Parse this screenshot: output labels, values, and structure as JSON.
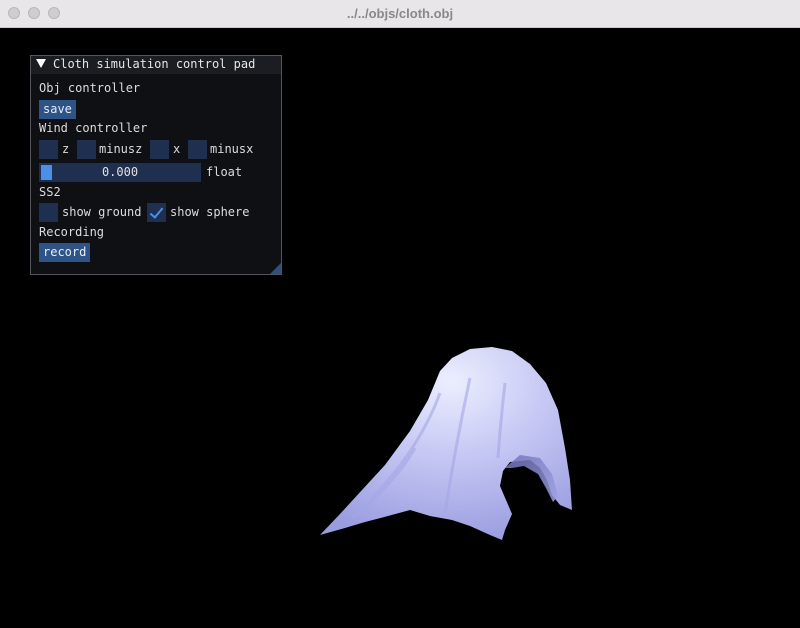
{
  "window": {
    "title": "../../objs/cloth.obj"
  },
  "panel": {
    "title": "Cloth simulation control pad",
    "obj_section": "Obj controller",
    "save_label": "save",
    "wind_section": "Wind controller",
    "wind_checks": [
      {
        "label": "z",
        "checked": false
      },
      {
        "label": "minusz",
        "checked": false
      },
      {
        "label": "x",
        "checked": false
      },
      {
        "label": "minusx",
        "checked": false
      }
    ],
    "slider_value": "0.000",
    "slider_label": "float",
    "ss2_section": "SS2",
    "show_ground_label": "show ground",
    "show_ground_checked": false,
    "show_sphere_label": "show sphere",
    "show_sphere_checked": true,
    "recording_section": "Recording",
    "record_label": "record"
  },
  "colors": {
    "cloth": "#c8caf6",
    "accent": "#4a90e8",
    "button": "#2e5387"
  }
}
